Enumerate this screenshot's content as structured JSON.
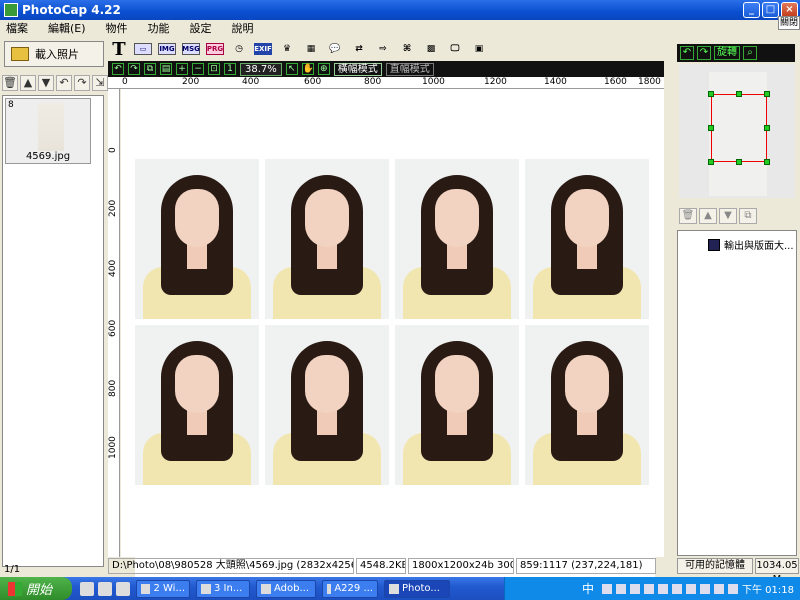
{
  "window": {
    "title": "PhotoCap 4.22"
  },
  "menu": [
    "檔案",
    "編輯(E)",
    "物件",
    "功能",
    "設定",
    "說明"
  ],
  "left": {
    "load_label": "載入照片",
    "thumb_index": "8",
    "thumb_filename": "4569.jpg",
    "page_count": "1/1"
  },
  "toolbar": {
    "zoom": "38.7%",
    "mode_landscape": "橫幅模式",
    "mode_portrait": "直幅模式"
  },
  "ruler": {
    "h_ticks": [
      "0",
      "200",
      "400",
      "600",
      "800",
      "1000",
      "1200",
      "1400",
      "1600",
      "1800"
    ],
    "v_ticks": [
      "0",
      "200",
      "400",
      "600",
      "800",
      "1000"
    ]
  },
  "right": {
    "close_label": "關閉",
    "rotate_label": "旋轉",
    "list_item": "輸出與版面大...",
    "mem_label": "可用的記憶體",
    "mem_value": "1034.05 M"
  },
  "status": {
    "path": "D:\\Photo\\08\\980528 大頭照\\4569.jpg (2832x4256x24)",
    "size": "4548.2KB",
    "res": "1800x1200x24b  300DPI",
    "coord": "859:1117 (237,224,181)"
  },
  "taskbar": {
    "start": "開始",
    "tasks": [
      "2 Wi...",
      "3 In...",
      "Adob...",
      "A229 ...",
      "Photo..."
    ],
    "ime": "中",
    "clock": "下午 01:18"
  }
}
